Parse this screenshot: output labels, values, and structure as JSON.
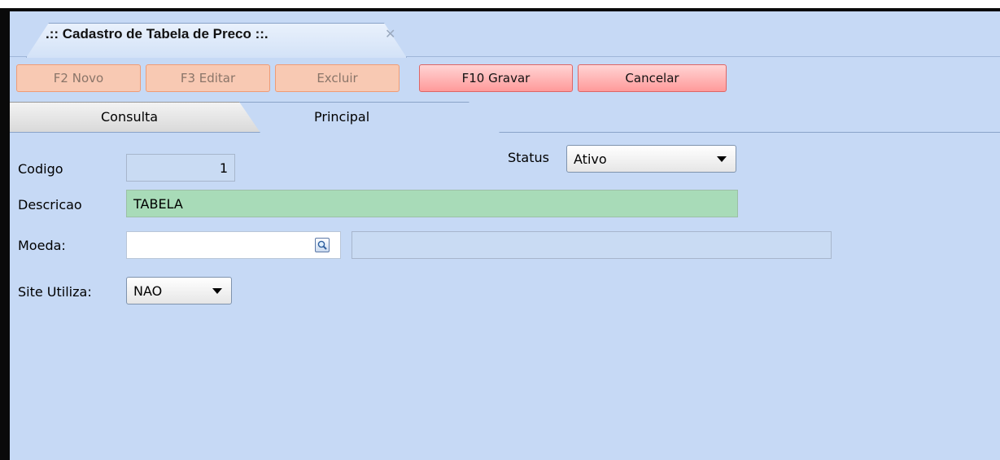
{
  "window": {
    "tab_title": ".:: Cadastro de Tabela de Preco ::.",
    "close_glyph": "✕"
  },
  "toolbar": {
    "new_label": "F2 Novo",
    "edit_label": "F3 Editar",
    "delete_label": "Excluir",
    "save_label": "F10 Gravar",
    "cancel_label": "Cancelar"
  },
  "form_tabs": {
    "consulta_label": "Consulta",
    "principal_label": "Principal",
    "active": "Principal"
  },
  "form": {
    "codigo_label": "Codigo",
    "codigo_value": "1",
    "status_label": "Status",
    "status_value": "Ativo",
    "descricao_label": "Descricao",
    "descricao_value": "TABELA",
    "moeda_label": "Moeda:",
    "moeda_value": "",
    "moeda_description": "",
    "site_label": "Site Utiliza:",
    "site_value": "NAO"
  },
  "icons": {
    "lookup": "magnifier-icon",
    "dropdown": "chevron-down-icon",
    "close": "close-icon"
  },
  "colors": {
    "background": "#c6d9f5",
    "required_field": "#a8dbb8",
    "active_button": "#ff9a9a",
    "disabled_button": "#f8c9b3"
  }
}
